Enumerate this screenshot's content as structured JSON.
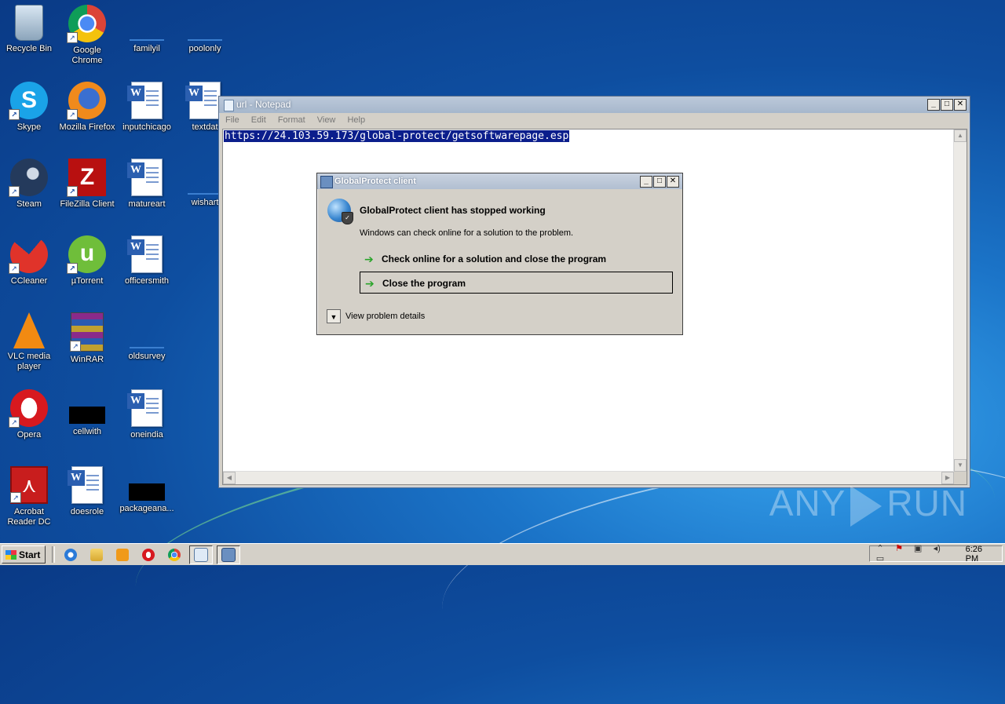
{
  "desktop": {
    "icons": [
      {
        "label": "Recycle Bin",
        "icon": "recycle-bin-icon"
      },
      {
        "label": "Google Chrome",
        "icon": "chrome-icon"
      },
      {
        "label": "familyil",
        "icon": "blank-file-icon"
      },
      {
        "label": "poolonly",
        "icon": "blank-file-icon"
      },
      {
        "label": "Skype",
        "icon": "skype-icon"
      },
      {
        "label": "Mozilla Firefox",
        "icon": "firefox-icon"
      },
      {
        "label": "inputchicago",
        "icon": "word-document-icon"
      },
      {
        "label": "textdat",
        "icon": "word-document-icon"
      },
      {
        "label": "Steam",
        "icon": "steam-icon"
      },
      {
        "label": "FileZilla Client",
        "icon": "filezilla-icon"
      },
      {
        "label": "matureart",
        "icon": "word-document-icon"
      },
      {
        "label": "wishart",
        "icon": "blank-file-icon"
      },
      {
        "label": "CCleaner",
        "icon": "ccleaner-icon"
      },
      {
        "label": "µTorrent",
        "icon": "utorrent-icon"
      },
      {
        "label": "officersmith",
        "icon": "word-document-icon"
      },
      {
        "label": "VLC media player",
        "icon": "vlc-icon"
      },
      {
        "label": "WinRAR",
        "icon": "winrar-icon"
      },
      {
        "label": "oldsurvey",
        "icon": "blank-file-icon"
      },
      {
        "label": "Opera",
        "icon": "opera-icon"
      },
      {
        "label": "cellwith",
        "icon": "black-thumbnail-icon"
      },
      {
        "label": "oneindia",
        "icon": "word-document-icon"
      },
      {
        "label": "Acrobat Reader DC",
        "icon": "acrobat-icon"
      },
      {
        "label": "doesrole",
        "icon": "word-document-icon"
      },
      {
        "label": "packageana...",
        "icon": "black-thumbnail-icon"
      }
    ]
  },
  "notepad": {
    "title": "url - Notepad",
    "menu": [
      "File",
      "Edit",
      "Format",
      "View",
      "Help"
    ],
    "content": "https://24.103.59.173/global-protect/getsoftwarepage.esp"
  },
  "dialog": {
    "title": "GlobalProtect client",
    "heading": "GlobalProtect client has stopped working",
    "message": "Windows can check online for a solution to the problem.",
    "option_check": "Check online for a solution and close the program",
    "option_close": "Close the program",
    "details": "View problem details"
  },
  "watermark": {
    "left": "ANY",
    "right": "RUN"
  },
  "taskbar": {
    "start": "Start",
    "pinned": [
      "internet-explorer-icon",
      "explorer-icon",
      "media-player-icon",
      "opera-icon",
      "chrome-icon",
      "notepad-icon",
      "globalprotect-icon"
    ],
    "clock": "6:26 PM"
  },
  "colors": {
    "selection": "#0b1e8c",
    "arrow_green": "#2aa42a",
    "desktop_blue": "#1b74c8"
  }
}
